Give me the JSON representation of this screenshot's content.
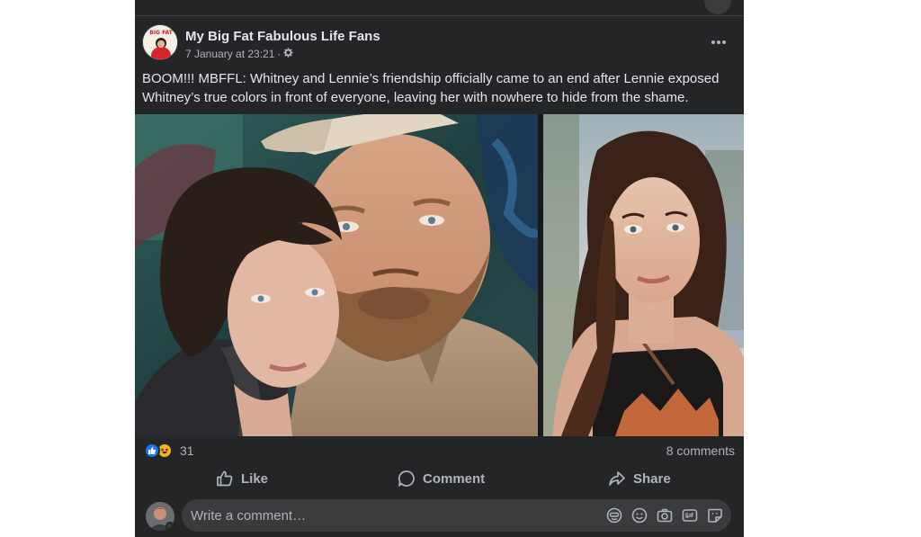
{
  "post": {
    "page_name": "My Big Fat Fabulous Life Fans",
    "timestamp": "7 January at 23:21",
    "separator": "·",
    "text": "BOOM!!! MBFFL: Whitney and Lennie’s friendship officially came to an end after Lennie exposed Whitney’s true colors in front of everyone, leaving her with nowhere to hide from the shame.",
    "avatar_label": "BIG FAT",
    "reactions_count": "31",
    "comments_count": "8 comments"
  },
  "actions": {
    "like": "Like",
    "comment": "Comment",
    "share": "Share"
  },
  "composer": {
    "placeholder": "Write a comment…"
  },
  "icons": {
    "more": "more-horizontal-icon",
    "audience": "gear-icon",
    "like_reaction": "like-reaction-icon",
    "haha_reaction": "haha-reaction-icon",
    "avatar": "avatar-icon",
    "emoji": "emoji-icon",
    "camera": "camera-icon",
    "gif": "gif-icon",
    "sticker": "sticker-icon"
  },
  "colors": {
    "background": "#242526",
    "text": "#e4e6eb",
    "secondary_text": "#b0b3b8",
    "like_blue": "#1877f2",
    "haha_yellow": "#f7b125"
  }
}
